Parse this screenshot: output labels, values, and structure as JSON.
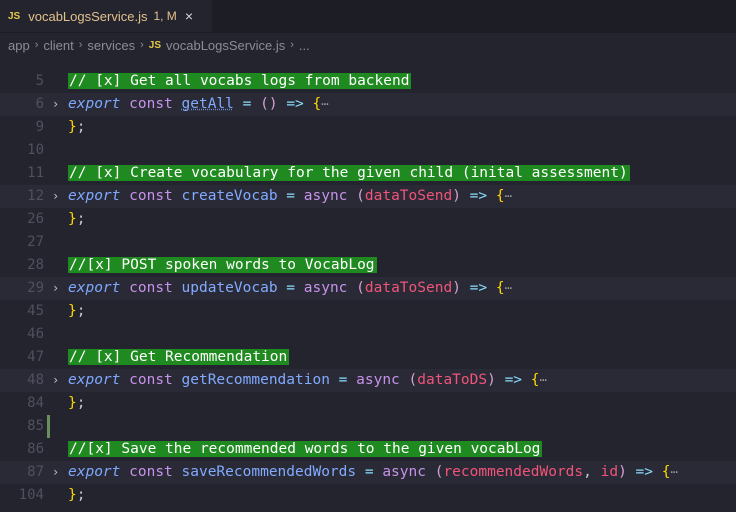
{
  "tab": {
    "icon": "JS",
    "filename": "vocabLogsService.js",
    "badge": "1, M",
    "close": "×"
  },
  "breadcrumb": {
    "items": [
      "app",
      "client",
      "services",
      "vocabLogsService.js",
      "..."
    ],
    "separator": "›",
    "file_icon": "JS"
  },
  "lines": [
    {
      "n": "5",
      "text": "// [x] Get all vocabs logs from backend"
    },
    {
      "n": "6",
      "export": "export",
      "const": "const",
      "name": "getAll",
      "eq": "=",
      "async": "",
      "params": "",
      "arrow": "=>",
      "brace": "{",
      "ellipsis": "⋯"
    },
    {
      "n": "9",
      "close": "};"
    },
    {
      "n": "10"
    },
    {
      "n": "11",
      "text": "// [x] Create vocabulary for the given child (inital assessment)"
    },
    {
      "n": "12",
      "export": "export",
      "const": "const",
      "name": "createVocab",
      "eq": "=",
      "async": "async",
      "params": "dataToSend",
      "arrow": "=>",
      "brace": "{",
      "ellipsis": "⋯"
    },
    {
      "n": "26",
      "close": "};"
    },
    {
      "n": "27"
    },
    {
      "n": "28",
      "text": "//[x] POST spoken words to VocabLog"
    },
    {
      "n": "29",
      "export": "export",
      "const": "const",
      "name": "updateVocab",
      "eq": "=",
      "async": "async",
      "params": "dataToSend",
      "arrow": "=>",
      "brace": "{",
      "ellipsis": "⋯"
    },
    {
      "n": "45",
      "close": "};"
    },
    {
      "n": "46"
    },
    {
      "n": "47",
      "text": "// [x] Get Recommendation"
    },
    {
      "n": "48",
      "export": "export",
      "const": "const",
      "name": "getRecommendation",
      "eq": "=",
      "async": "async",
      "params": "dataToDS",
      "arrow": "=>",
      "brace": "{",
      "ellipsis": "⋯"
    },
    {
      "n": "84",
      "close": "};"
    },
    {
      "n": "85"
    },
    {
      "n": "86",
      "text": "//[x] Save the recommended words to the given vocabLog"
    },
    {
      "n": "87",
      "export": "export",
      "const": "const",
      "name": "saveRecommendedWords",
      "eq": "=",
      "async": "async",
      "params": "recommendedWords",
      "params2": "id",
      "arrow": "=>",
      "brace": "{",
      "ellipsis": "⋯"
    },
    {
      "n": "104",
      "close": "};"
    }
  ]
}
